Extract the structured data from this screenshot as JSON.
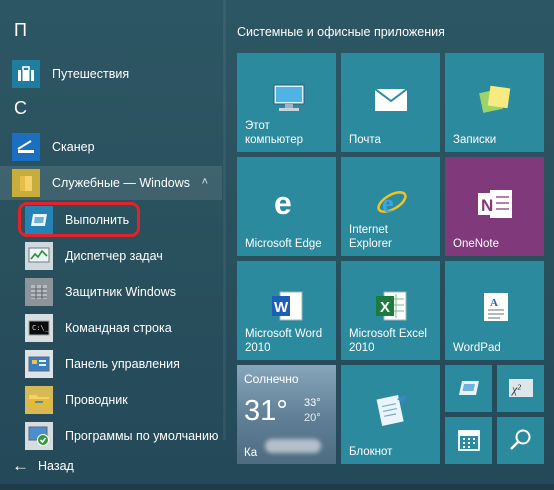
{
  "app_list": {
    "letters": [
      "П",
      "С"
    ],
    "items": [
      {
        "label": "Путешествия",
        "icon": "suitcase-icon"
      },
      {
        "label": "Сканер",
        "icon": "scanner-icon"
      },
      {
        "label": "Служебные — Windows",
        "icon": "folder-icon",
        "expand": "˄"
      },
      {
        "label": "Выполнить",
        "icon": "run-icon"
      },
      {
        "label": "Диспетчер задач",
        "icon": "task-manager-icon"
      },
      {
        "label": "Защитник Windows",
        "icon": "windows-defender-icon"
      },
      {
        "label": "Командная строка",
        "icon": "command-prompt-icon"
      },
      {
        "label": "Панель управления",
        "icon": "control-panel-icon"
      },
      {
        "label": "Проводник",
        "icon": "file-explorer-icon"
      },
      {
        "label": "Программы по умолчанию",
        "icon": "default-programs-icon"
      }
    ],
    "back": {
      "label": "Назад",
      "glyph": "←"
    }
  },
  "tiles": {
    "group_title": "Системные и офисные приложения",
    "items": [
      {
        "label": "Этот\nкомпьютер",
        "icon": "computer-icon"
      },
      {
        "label": "Почта",
        "icon": "mail-icon"
      },
      {
        "label": "Записки",
        "icon": "sticky-notes-icon"
      },
      {
        "label": "Microsoft Edge",
        "icon": "edge-icon"
      },
      {
        "label": "Internet\nExplorer",
        "icon": "internet-explorer-icon"
      },
      {
        "label": "OneNote",
        "icon": "onenote-icon"
      },
      {
        "label": "Microsoft Word\n2010",
        "icon": "word-icon"
      },
      {
        "label": "Microsoft Excel\n2010",
        "icon": "excel-icon"
      },
      {
        "label": "WordPad",
        "icon": "wordpad-icon"
      },
      {
        "label": "Блокнот",
        "icon": "notepad-icon"
      },
      {
        "label": "",
        "icon": "run-icon"
      },
      {
        "label": "",
        "icon": "math-input-icon"
      },
      {
        "label": "",
        "icon": "calendar-icon"
      },
      {
        "label": "",
        "icon": "search-icon"
      }
    ],
    "weather": {
      "condition": "Солнечно",
      "temp": "31°",
      "high": "33°",
      "low": "20°",
      "city": "Ка"
    }
  },
  "colors": {
    "background": "#29505d",
    "tile": "#2c8a9f",
    "onenote": "#80397b",
    "highlight_ring": "#e3222a"
  }
}
